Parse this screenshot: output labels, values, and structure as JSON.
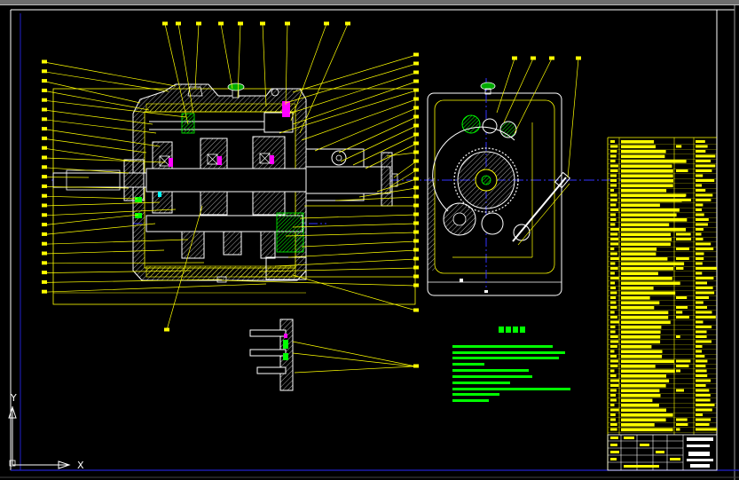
{
  "viewport": {
    "background": "#000000"
  },
  "ucs_icon": {
    "x_label": "X",
    "y_label": "Y"
  },
  "colors": {
    "line_yellow": "#ffff00",
    "line_white": "#ffffff",
    "line_green": "#00ff00",
    "line_magenta": "#ff00ff",
    "center_blue": "#3333ff",
    "frame_blue": "#2222cc"
  },
  "icons": {
    "ucs": "ucs-axis-icon"
  }
}
